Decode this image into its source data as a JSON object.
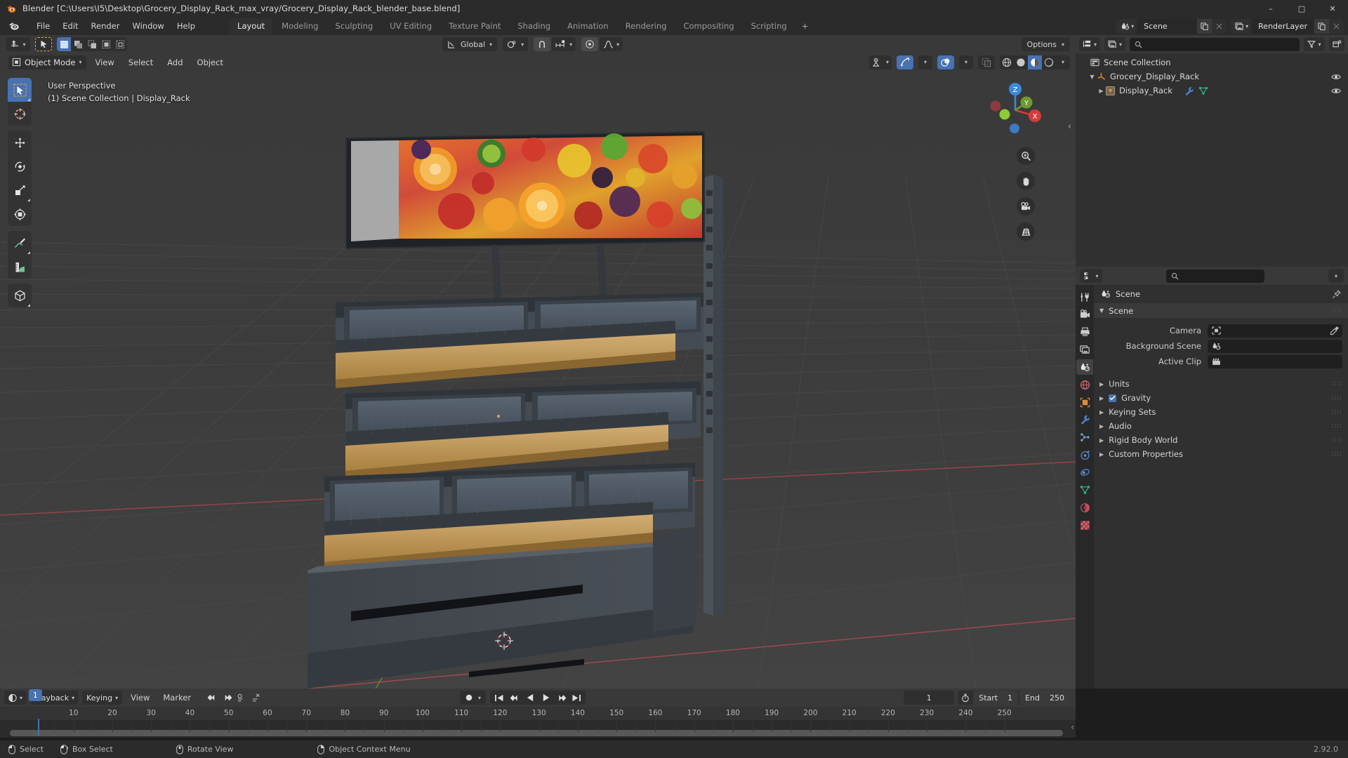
{
  "window": {
    "title": "Blender [C:\\Users\\I5\\Desktop\\Grocery_Display_Rack_max_vray/Grocery_Display_Rack_blender_base.blend]",
    "minimize": "–",
    "maximize": "□",
    "close": "✕"
  },
  "menubar": {
    "items": [
      "File",
      "Edit",
      "Render",
      "Window",
      "Help"
    ],
    "workspaces": [
      {
        "label": "Layout",
        "active": true
      },
      {
        "label": "Modeling",
        "active": false
      },
      {
        "label": "Sculpting",
        "active": false
      },
      {
        "label": "UV Editing",
        "active": false
      },
      {
        "label": "Texture Paint",
        "active": false
      },
      {
        "label": "Shading",
        "active": false
      },
      {
        "label": "Animation",
        "active": false
      },
      {
        "label": "Rendering",
        "active": false
      },
      {
        "label": "Compositing",
        "active": false
      },
      {
        "label": "Scripting",
        "active": false
      }
    ],
    "add_workspace": "+",
    "scene_name": "Scene",
    "viewlayer_name": "RenderLayer"
  },
  "viewport_toolbar": {
    "transform_orientation": "Global",
    "options_label": "Options",
    "snap_dropdown": "⌄",
    "proportional_dropdown": "⌄"
  },
  "viewport_header": {
    "mode": "Object Mode",
    "menus": [
      "View",
      "Select",
      "Add",
      "Object"
    ]
  },
  "viewport": {
    "perspective_label": "User Perspective",
    "scene_label": "(1) Scene Collection | Display_Rack",
    "gizmo_axes": {
      "x": "X",
      "y": "Y",
      "z": "Z"
    },
    "tools": [
      "tweak-tool",
      "cursor-tool",
      "move-tool",
      "rotate-tool",
      "scale-tool",
      "transform-tool",
      "annotate-tool",
      "measure-tool",
      "add-cube-tool"
    ],
    "nav_buttons": [
      "zoom-icon",
      "hand-icon",
      "camera-icon",
      "grid-icon"
    ],
    "collapse_arrow": "‹"
  },
  "outliner": {
    "search_placeholder": "",
    "filter_icon": "filter-icon",
    "new_collection_icon": "new-collection-icon",
    "rows": [
      {
        "label": "Scene Collection",
        "indent": 0,
        "icon": "collection-icon",
        "disclosure": "",
        "eye": false
      },
      {
        "label": "Grocery_Display_Rack",
        "indent": 1,
        "icon": "empty-axes-icon",
        "disclosure": "▼",
        "eye": true
      },
      {
        "label": "Display_Rack",
        "indent": 2,
        "icon": "mesh-object-icon",
        "disclosure": "▶",
        "eye": true,
        "extra_icons": [
          "modifier-icon",
          "mesh-data-icon"
        ]
      }
    ]
  },
  "properties": {
    "search_placeholder": "",
    "breadcrumb": "Scene",
    "tabs": [
      "tool-icon",
      "render-icon",
      "output-icon",
      "view-layer-icon",
      "scene-icon",
      "world-icon",
      "object-icon",
      "modifier-icon",
      "particles-icon",
      "physics-icon",
      "constraints-icon",
      "data-icon",
      "material-icon",
      "texture-icon"
    ],
    "active_tab_index": 4,
    "panel_title": "Scene",
    "rows": [
      {
        "label": "Camera",
        "value": "",
        "icon": "camera-field-icon",
        "eyedropper": true
      },
      {
        "label": "Background Scene",
        "value": "",
        "icon": "scene-field-icon",
        "eyedropper": false
      },
      {
        "label": "Active Clip",
        "value": "",
        "icon": "clip-field-icon",
        "eyedropper": false
      }
    ],
    "sections": [
      {
        "label": "Units",
        "checkbox": null
      },
      {
        "label": "Gravity",
        "checkbox": true
      },
      {
        "label": "Keying Sets",
        "checkbox": null
      },
      {
        "label": "Audio",
        "checkbox": null
      },
      {
        "label": "Rigid Body World",
        "checkbox": null
      },
      {
        "label": "Custom Properties",
        "checkbox": null
      }
    ]
  },
  "timeline": {
    "menus": [
      "Playback",
      "Keying",
      "View",
      "Marker"
    ],
    "current_frame": "1",
    "start_label": "Start",
    "start_value": "1",
    "end_label": "End",
    "end_value": "250",
    "playhead_label": "1",
    "ticks": [
      10,
      20,
      30,
      40,
      50,
      60,
      70,
      80,
      90,
      100,
      110,
      120,
      130,
      140,
      150,
      160,
      170,
      180,
      190,
      200,
      210,
      220,
      230,
      240,
      250
    ],
    "range_min": 1,
    "range_max": 250
  },
  "statusbar": {
    "items": [
      {
        "icon": "mouse-left-icon",
        "label": "Select"
      },
      {
        "icon": "mouse-left-drag-icon",
        "label": "Box Select"
      },
      {
        "icon": "mouse-middle-icon",
        "label": "Rotate View"
      },
      {
        "icon": "mouse-right-icon",
        "label": "Object Context Menu"
      }
    ],
    "version": "2.92.0"
  },
  "colors": {
    "accent_blue": "#4772b3",
    "header_gray": "#393939",
    "panel_gray": "#303030",
    "viewport_bg": "#3b3b3b",
    "axis_red": "#b54b4b",
    "axis_green": "#7fa34a",
    "wood": "#c9a26a"
  }
}
